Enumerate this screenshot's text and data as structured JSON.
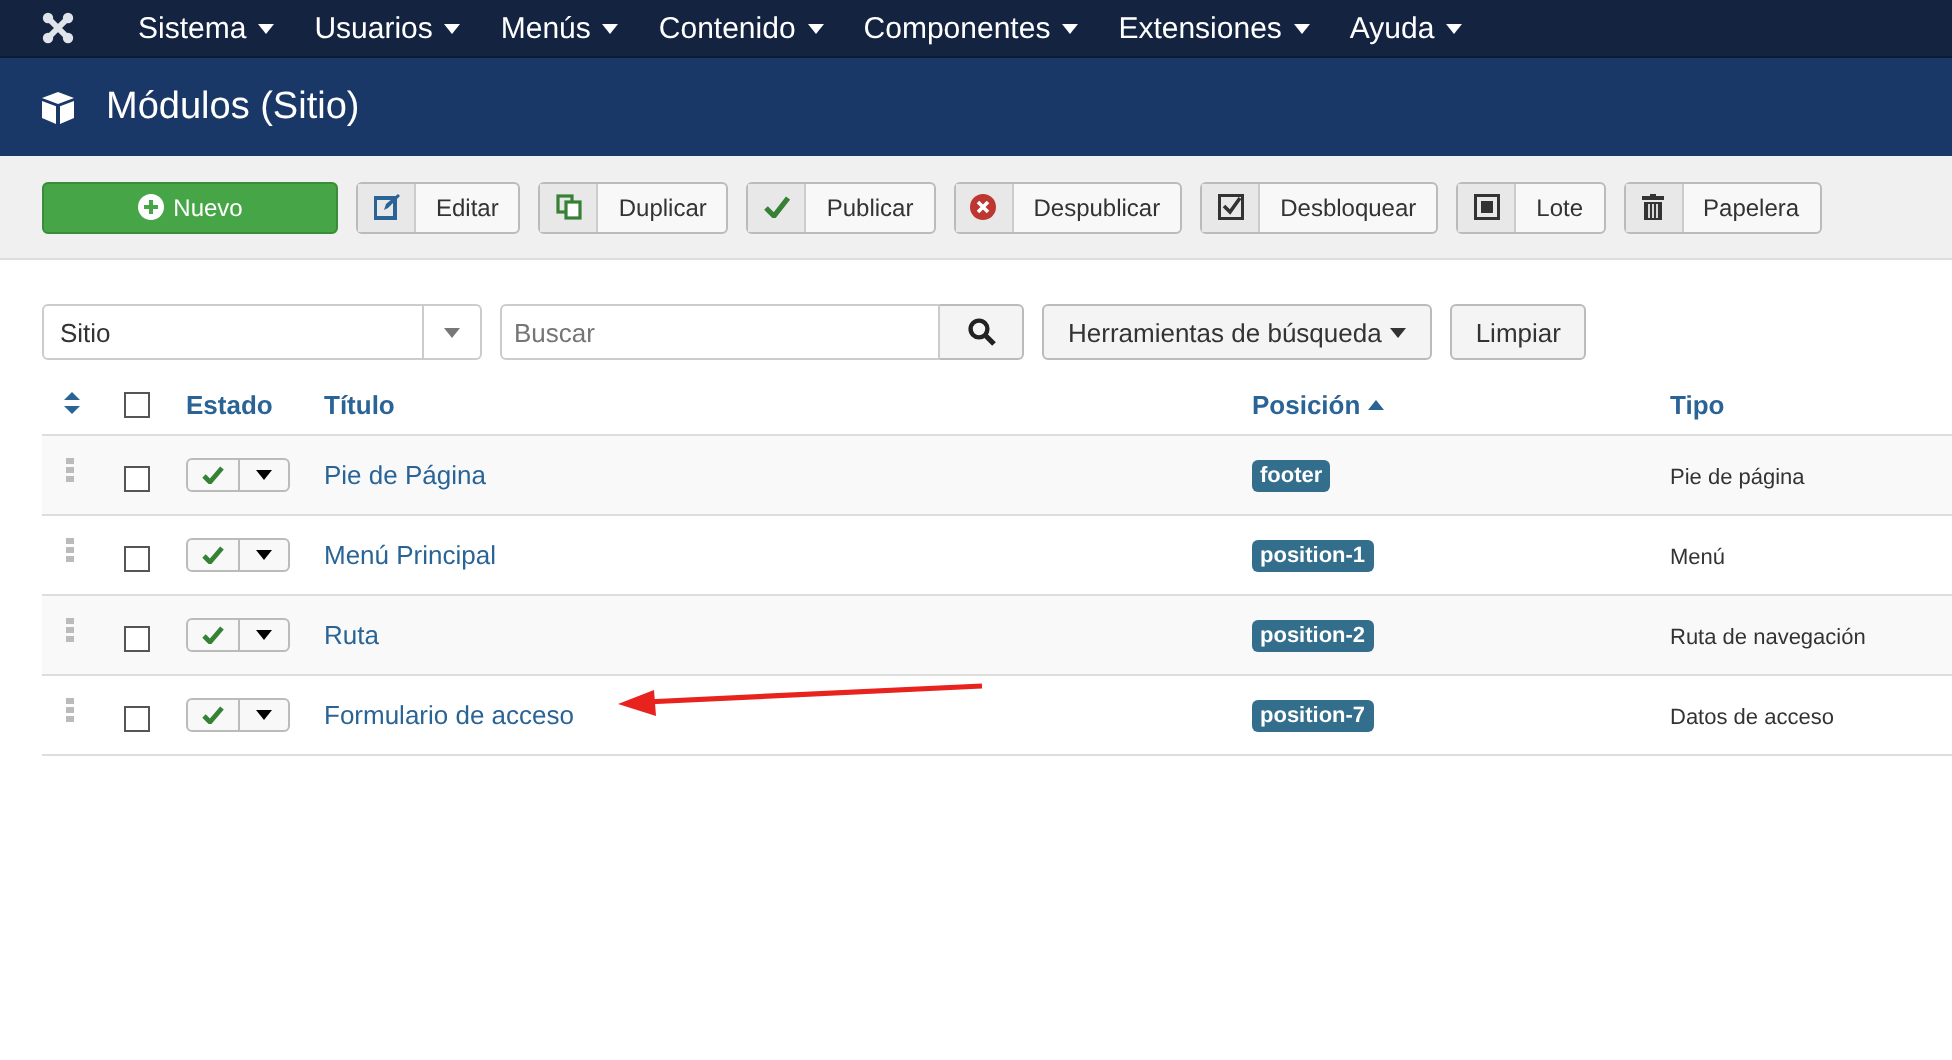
{
  "menu": [
    "Sistema",
    "Usuarios",
    "Menús",
    "Contenido",
    "Componentes",
    "Extensiones",
    "Ayuda"
  ],
  "header": {
    "title": "Módulos (Sitio)"
  },
  "toolbar": [
    {
      "label": "Nuevo",
      "kind": "new"
    },
    {
      "label": "Editar",
      "kind": "edit"
    },
    {
      "label": "Duplicar",
      "kind": "copy"
    },
    {
      "label": "Publicar",
      "kind": "publish"
    },
    {
      "label": "Despublicar",
      "kind": "unpublish"
    },
    {
      "label": "Desbloquear",
      "kind": "checkin"
    },
    {
      "label": "Lote",
      "kind": "batch"
    },
    {
      "label": "Papelera",
      "kind": "trash"
    }
  ],
  "filters": {
    "client": "Sitio",
    "search_placeholder": "Buscar",
    "tools": "Herramientas de búsqueda",
    "clear": "Limpiar"
  },
  "table": {
    "columns": [
      "Estado",
      "Título",
      "Posición",
      "Tipo"
    ],
    "select_all_checked": false,
    "rows": [
      {
        "title": "Pie de Página",
        "position": "footer",
        "type": "Pie de página",
        "published": true,
        "checked": false
      },
      {
        "title": "Menú Principal",
        "position": "position-1",
        "type": "Menú",
        "published": true,
        "checked": false
      },
      {
        "title": "Ruta",
        "position": "position-2",
        "type": "Ruta de navegación",
        "published": true,
        "checked": false
      },
      {
        "title": "Formulario de acceso",
        "position": "position-7",
        "type": "Datos de acceso",
        "published": true,
        "checked": false
      }
    ]
  }
}
